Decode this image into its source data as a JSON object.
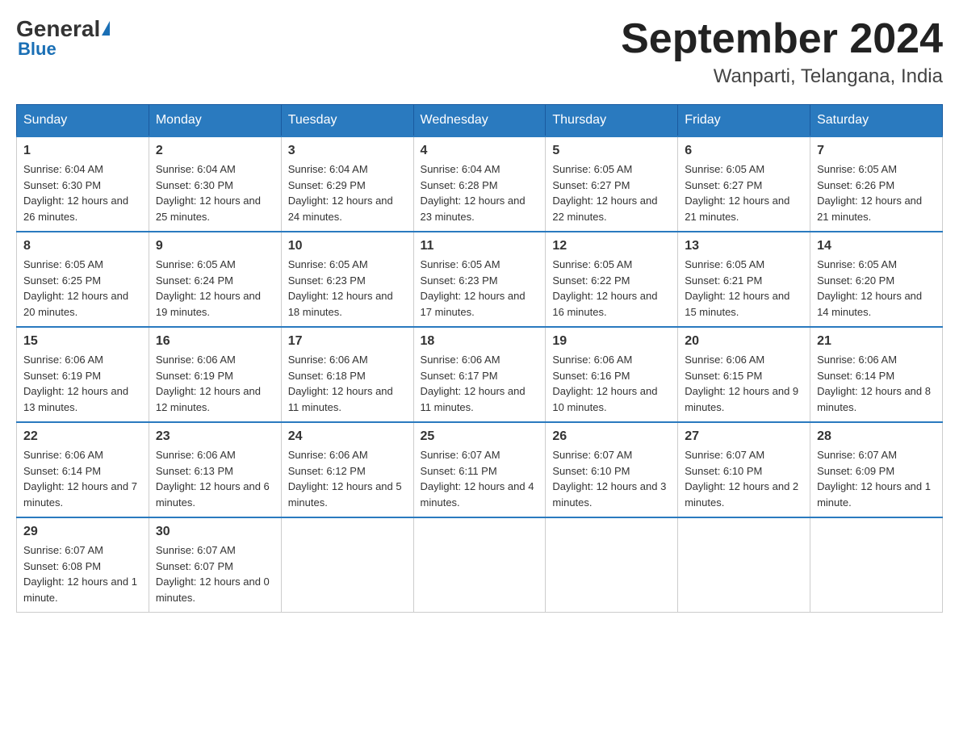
{
  "logo": {
    "general": "General",
    "blue": "Blue",
    "subtitle": "Blue"
  },
  "header": {
    "month_year": "September 2024",
    "location": "Wanparti, Telangana, India"
  },
  "columns": [
    "Sunday",
    "Monday",
    "Tuesday",
    "Wednesday",
    "Thursday",
    "Friday",
    "Saturday"
  ],
  "weeks": [
    [
      {
        "day": "1",
        "sunrise": "6:04 AM",
        "sunset": "6:30 PM",
        "daylight": "12 hours and 26 minutes."
      },
      {
        "day": "2",
        "sunrise": "6:04 AM",
        "sunset": "6:30 PM",
        "daylight": "12 hours and 25 minutes."
      },
      {
        "day": "3",
        "sunrise": "6:04 AM",
        "sunset": "6:29 PM",
        "daylight": "12 hours and 24 minutes."
      },
      {
        "day": "4",
        "sunrise": "6:04 AM",
        "sunset": "6:28 PM",
        "daylight": "12 hours and 23 minutes."
      },
      {
        "day": "5",
        "sunrise": "6:05 AM",
        "sunset": "6:27 PM",
        "daylight": "12 hours and 22 minutes."
      },
      {
        "day": "6",
        "sunrise": "6:05 AM",
        "sunset": "6:27 PM",
        "daylight": "12 hours and 21 minutes."
      },
      {
        "day": "7",
        "sunrise": "6:05 AM",
        "sunset": "6:26 PM",
        "daylight": "12 hours and 21 minutes."
      }
    ],
    [
      {
        "day": "8",
        "sunrise": "6:05 AM",
        "sunset": "6:25 PM",
        "daylight": "12 hours and 20 minutes."
      },
      {
        "day": "9",
        "sunrise": "6:05 AM",
        "sunset": "6:24 PM",
        "daylight": "12 hours and 19 minutes."
      },
      {
        "day": "10",
        "sunrise": "6:05 AM",
        "sunset": "6:23 PM",
        "daylight": "12 hours and 18 minutes."
      },
      {
        "day": "11",
        "sunrise": "6:05 AM",
        "sunset": "6:23 PM",
        "daylight": "12 hours and 17 minutes."
      },
      {
        "day": "12",
        "sunrise": "6:05 AM",
        "sunset": "6:22 PM",
        "daylight": "12 hours and 16 minutes."
      },
      {
        "day": "13",
        "sunrise": "6:05 AM",
        "sunset": "6:21 PM",
        "daylight": "12 hours and 15 minutes."
      },
      {
        "day": "14",
        "sunrise": "6:05 AM",
        "sunset": "6:20 PM",
        "daylight": "12 hours and 14 minutes."
      }
    ],
    [
      {
        "day": "15",
        "sunrise": "6:06 AM",
        "sunset": "6:19 PM",
        "daylight": "12 hours and 13 minutes."
      },
      {
        "day": "16",
        "sunrise": "6:06 AM",
        "sunset": "6:19 PM",
        "daylight": "12 hours and 12 minutes."
      },
      {
        "day": "17",
        "sunrise": "6:06 AM",
        "sunset": "6:18 PM",
        "daylight": "12 hours and 11 minutes."
      },
      {
        "day": "18",
        "sunrise": "6:06 AM",
        "sunset": "6:17 PM",
        "daylight": "12 hours and 11 minutes."
      },
      {
        "day": "19",
        "sunrise": "6:06 AM",
        "sunset": "6:16 PM",
        "daylight": "12 hours and 10 minutes."
      },
      {
        "day": "20",
        "sunrise": "6:06 AM",
        "sunset": "6:15 PM",
        "daylight": "12 hours and 9 minutes."
      },
      {
        "day": "21",
        "sunrise": "6:06 AM",
        "sunset": "6:14 PM",
        "daylight": "12 hours and 8 minutes."
      }
    ],
    [
      {
        "day": "22",
        "sunrise": "6:06 AM",
        "sunset": "6:14 PM",
        "daylight": "12 hours and 7 minutes."
      },
      {
        "day": "23",
        "sunrise": "6:06 AM",
        "sunset": "6:13 PM",
        "daylight": "12 hours and 6 minutes."
      },
      {
        "day": "24",
        "sunrise": "6:06 AM",
        "sunset": "6:12 PM",
        "daylight": "12 hours and 5 minutes."
      },
      {
        "day": "25",
        "sunrise": "6:07 AM",
        "sunset": "6:11 PM",
        "daylight": "12 hours and 4 minutes."
      },
      {
        "day": "26",
        "sunrise": "6:07 AM",
        "sunset": "6:10 PM",
        "daylight": "12 hours and 3 minutes."
      },
      {
        "day": "27",
        "sunrise": "6:07 AM",
        "sunset": "6:10 PM",
        "daylight": "12 hours and 2 minutes."
      },
      {
        "day": "28",
        "sunrise": "6:07 AM",
        "sunset": "6:09 PM",
        "daylight": "12 hours and 1 minute."
      }
    ],
    [
      {
        "day": "29",
        "sunrise": "6:07 AM",
        "sunset": "6:08 PM",
        "daylight": "12 hours and 1 minute."
      },
      {
        "day": "30",
        "sunrise": "6:07 AM",
        "sunset": "6:07 PM",
        "daylight": "12 hours and 0 minutes."
      },
      null,
      null,
      null,
      null,
      null
    ]
  ],
  "labels": {
    "sunrise": "Sunrise:",
    "sunset": "Sunset:",
    "daylight": "Daylight:"
  }
}
